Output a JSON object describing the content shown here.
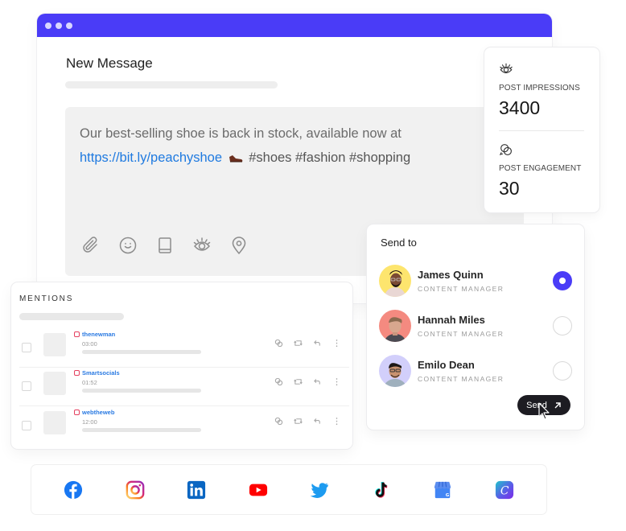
{
  "window": {
    "title": "New Message",
    "accent_color": "#4a3cf7"
  },
  "composer": {
    "text_line1": "Our best-selling shoe is back in stock, available now at",
    "link": "https://bit.ly/peachyshoe",
    "emoji": "shoe-emoji",
    "hashtags": "#shoes #fashion #shopping",
    "toolbar": [
      {
        "icon": "paperclip-icon",
        "label": "Attach"
      },
      {
        "icon": "smiley-icon",
        "label": "Emoji"
      },
      {
        "icon": "book-icon",
        "label": "Library"
      },
      {
        "icon": "eye-icon",
        "label": "Preview"
      },
      {
        "icon": "location-pin-icon",
        "label": "Location"
      }
    ]
  },
  "stats": {
    "impressions": {
      "label": "POST IMPRESSIONS",
      "value": "3400",
      "icon": "eye-icon"
    },
    "engagement": {
      "label": "POST ENGAGEMENT",
      "value": "30",
      "icon": "chat-bubbles-icon"
    }
  },
  "send_to": {
    "title": "Send to",
    "contacts": [
      {
        "name": "James Quinn",
        "role": "CONTENT MANAGER",
        "avatar_bg": "#fde56e",
        "selected": true
      },
      {
        "name": "Hannah Miles",
        "role": "CONTENT MANAGER",
        "avatar_bg": "#f48a80",
        "selected": false
      },
      {
        "name": "Emilo Dean",
        "role": "CONTENT MANAGER",
        "avatar_bg": "#d2cffb",
        "selected": false
      }
    ],
    "send_label": "Send"
  },
  "mentions": {
    "title": "MENTIONS",
    "rows": [
      {
        "handle": "thenewman",
        "time": "03:00",
        "platform": "instagram"
      },
      {
        "handle": "Smartsocials",
        "time": "01:52",
        "platform": "instagram"
      },
      {
        "handle": "webtheweb",
        "time": "12:00",
        "platform": "instagram"
      }
    ],
    "actions": [
      "engage-icon",
      "retweet-icon",
      "reply-icon",
      "more-icon"
    ]
  },
  "social_networks": [
    "Facebook",
    "Instagram",
    "LinkedIn",
    "YouTube",
    "Twitter",
    "TikTok",
    "Google Business Profile",
    "Canva"
  ]
}
